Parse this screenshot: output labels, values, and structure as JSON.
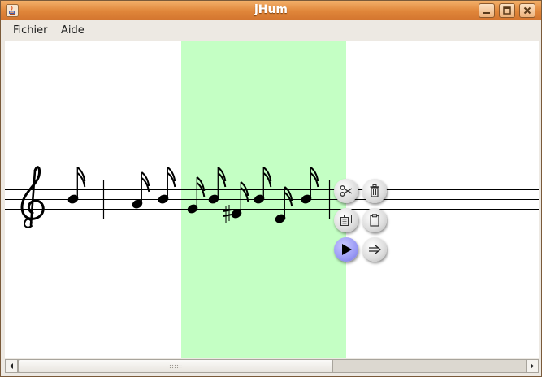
{
  "window": {
    "title": "jHum"
  },
  "menubar": {
    "items": [
      "Fichier",
      "Aide"
    ]
  },
  "toolbar": {
    "cut": "scissors-icon",
    "delete": "trash-icon",
    "copy": "copy-icon",
    "paste": "clipboard-icon",
    "play": "play-icon",
    "next": "arrow-right-icon"
  },
  "colors": {
    "titlebar": "#e0863a",
    "selection": "#c4ffc4",
    "play_button": "#9a9af5"
  }
}
